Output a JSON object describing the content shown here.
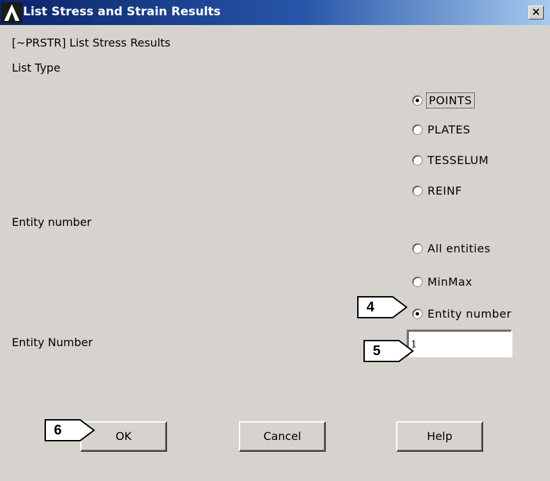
{
  "window": {
    "title": "List Stress and Strain Results",
    "logo_icon": "ansys-logo-icon",
    "close_icon": "close-x-icon"
  },
  "header": {
    "command_label": "[~PRSTR] List Stress Results",
    "list_type_label": "List Type"
  },
  "list_type": {
    "selected": "POINTS",
    "options": [
      "POINTS",
      "PLATES",
      "TESSELUM",
      "REINF"
    ]
  },
  "entity": {
    "section_label": "Entity number",
    "selected": "Entity number",
    "options": [
      "All entities",
      "MinMax",
      "Entity number"
    ]
  },
  "entity_number": {
    "label": "Entity Number",
    "value": "1"
  },
  "buttons": {
    "ok": "OK",
    "cancel": "Cancel",
    "help": "Help"
  },
  "callouts": [
    "4",
    "5",
    "6"
  ],
  "colors": {
    "dialog_bg": "#d6d3ce",
    "titlebar_start": "#0a246a",
    "titlebar_end": "#a6caf0"
  }
}
